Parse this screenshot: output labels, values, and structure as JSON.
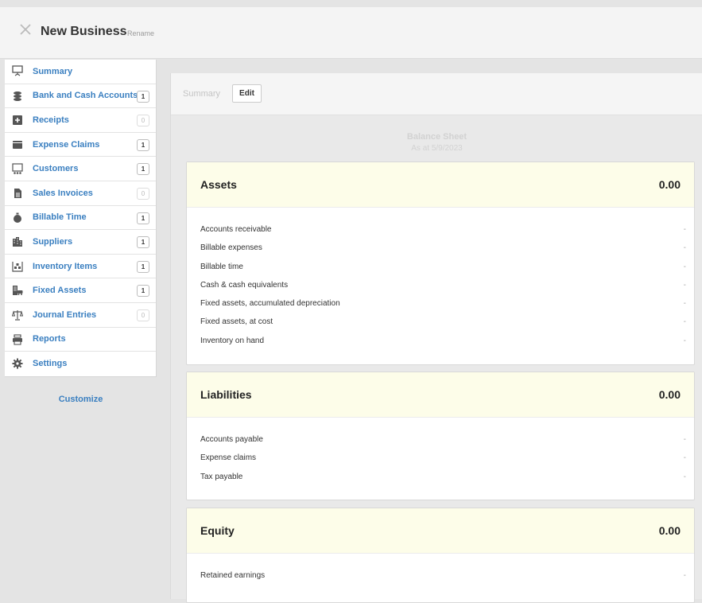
{
  "header": {
    "business_name": "New Business",
    "rename_label": "Rename"
  },
  "sidebar": {
    "items": [
      {
        "label": "Summary",
        "icon": "presentation-icon",
        "badge": ""
      },
      {
        "label": "Bank and Cash Accounts",
        "icon": "coins-icon",
        "badge": "1"
      },
      {
        "label": "Receipts",
        "icon": "plus-box-icon",
        "badge": "0"
      },
      {
        "label": "Expense Claims",
        "icon": "wallet-icon",
        "badge": "1"
      },
      {
        "label": "Customers",
        "icon": "people-icon",
        "badge": "1"
      },
      {
        "label": "Sales Invoices",
        "icon": "document-icon",
        "badge": "0"
      },
      {
        "label": "Billable Time",
        "icon": "stopwatch-icon",
        "badge": "1"
      },
      {
        "label": "Suppliers",
        "icon": "factory-icon",
        "badge": "1"
      },
      {
        "label": "Inventory Items",
        "icon": "warehouse-icon",
        "badge": "1"
      },
      {
        "label": "Fixed Assets",
        "icon": "building-car-icon",
        "badge": "1"
      },
      {
        "label": "Journal Entries",
        "icon": "scales-icon",
        "badge": "0"
      },
      {
        "label": "Reports",
        "icon": "printer-icon",
        "badge": ""
      },
      {
        "label": "Settings",
        "icon": "gear-icon",
        "badge": ""
      }
    ],
    "customize_label": "Customize"
  },
  "main": {
    "toolbar": {
      "label": "Summary",
      "edit_label": "Edit"
    },
    "balance_sheet": {
      "title": "Balance Sheet",
      "date": "As at 5/9/2023"
    },
    "sections": [
      {
        "title": "Assets",
        "total": "0.00",
        "rows": [
          {
            "label": "Accounts receivable",
            "value": "-"
          },
          {
            "label": "Billable expenses",
            "value": "-"
          },
          {
            "label": "Billable time",
            "value": "-"
          },
          {
            "label": "Cash & cash equivalents",
            "value": "-"
          },
          {
            "label": "Fixed assets, accumulated depreciation",
            "value": "-"
          },
          {
            "label": "Fixed assets, at cost",
            "value": "-"
          },
          {
            "label": "Inventory on hand",
            "value": "-"
          }
        ]
      },
      {
        "title": "Liabilities",
        "total": "0.00",
        "rows": [
          {
            "label": "Accounts payable",
            "value": "-"
          },
          {
            "label": "Expense claims",
            "value": "-"
          },
          {
            "label": "Tax payable",
            "value": "-"
          }
        ]
      },
      {
        "title": "Equity",
        "total": "0.00",
        "rows": [
          {
            "label": "Retained earnings",
            "value": "-"
          }
        ]
      }
    ]
  },
  "colors": {
    "link": "#3a7fc0",
    "card_header": "#fdfde9"
  }
}
